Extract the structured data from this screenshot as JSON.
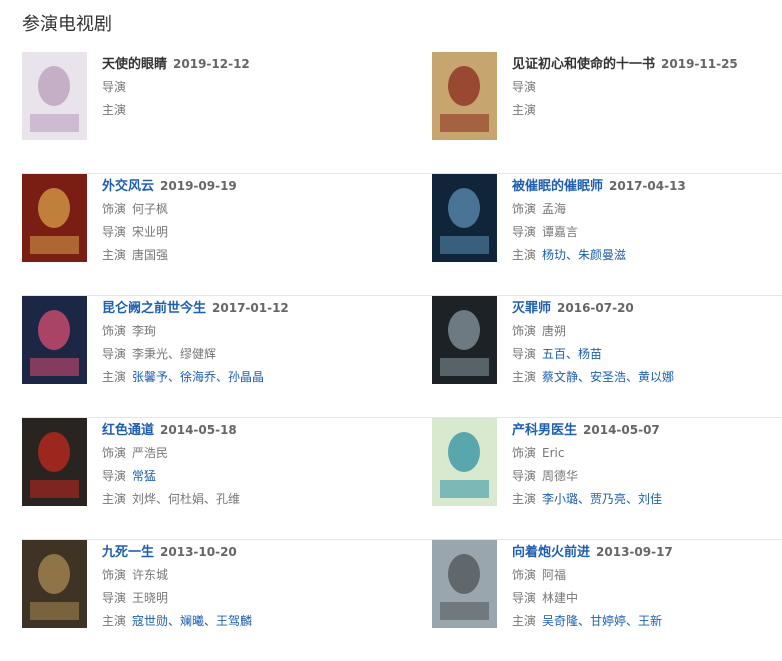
{
  "section": {
    "title": "参演电视剧"
  },
  "labels": {
    "role": "饰演",
    "director": "导演",
    "cast": "主演"
  },
  "rows": [
    [
      {
        "title": "天使的眼睛",
        "title_link": false,
        "date": "2019-12-12",
        "role": "",
        "director": "",
        "cast": "",
        "poster": {
          "bg": "#e9e3ec",
          "accent": "#b79dbb"
        }
      },
      {
        "title": "见证初心和使命的十一书",
        "title_link": false,
        "date": "2019-11-25",
        "role": "",
        "director": "",
        "cast": "",
        "poster": {
          "bg": "#c6a56e",
          "accent": "#8a2b1e"
        }
      }
    ],
    [
      {
        "title": "外交风云",
        "title_link": true,
        "date": "2019-09-19",
        "role": "何子枫",
        "director": "宋业明",
        "cast": "唐国强",
        "poster": {
          "bg": "#7a1e14",
          "accent": "#d8a24a"
        }
      },
      {
        "title": "被催眠的催眠师",
        "title_link": true,
        "date": "2017-04-13",
        "role": "孟海",
        "director": "谭嘉言",
        "cast": "杨玏、朱颜曼滋",
        "poster": {
          "bg": "#10243a",
          "accent": "#5d8fb4"
        }
      }
    ],
    [
      {
        "title": "昆仑阙之前世今生",
        "title_link": true,
        "date": "2017-01-12",
        "role": "李珣",
        "director": "李秉光、缪健辉",
        "cast": "张馨予、徐海乔、孙晶晶",
        "poster": {
          "bg": "#1b2744",
          "accent": "#d94f73"
        }
      },
      {
        "title": "灭罪师",
        "title_link": true,
        "date": "2016-07-20",
        "role": "唐朔",
        "director": "五百、杨苗",
        "cast": "蔡文静、安圣浩、黄以娜",
        "poster": {
          "bg": "#1c2226",
          "accent": "#8a98a0"
        }
      }
    ],
    [
      {
        "title": "红色通道",
        "title_link": true,
        "date": "2014-05-18",
        "role": "严浩民",
        "director": "常猛",
        "cast": "刘烨、何杜娟、孔维",
        "poster": {
          "bg": "#2a2421",
          "accent": "#c1281f"
        }
      },
      {
        "title": "产科男医生",
        "title_link": true,
        "date": "2014-05-07",
        "role": "Eric",
        "director": "周德华",
        "cast": "李小璐、贾乃亮、刘佳",
        "poster": {
          "bg": "#d9e9cf",
          "accent": "#2e8fa2"
        }
      }
    ],
    [
      {
        "title": "九死一生",
        "title_link": true,
        "date": "2013-10-20",
        "role": "许东城",
        "director": "王晓明",
        "cast": "寇世勋、斓曦、王驾麟",
        "poster": {
          "bg": "#3e3324",
          "accent": "#a98b53"
        }
      },
      {
        "title": "向着炮火前进",
        "title_link": true,
        "date": "2013-09-17",
        "role": "阿福",
        "director": "林建中",
        "cast": "吴奇隆、甘婷婷、王新",
        "poster": {
          "bg": "#9aa6ad",
          "accent": "#4c5357"
        }
      }
    ]
  ],
  "link_flags": {
    "director_links": [
      [
        false,
        false
      ],
      [
        false,
        false
      ],
      [
        false,
        true
      ],
      [
        true,
        false
      ],
      [
        false,
        false
      ]
    ],
    "cast_links": [
      [
        false,
        false
      ],
      [
        false,
        true
      ],
      [
        true,
        true
      ],
      [
        false,
        true
      ],
      [
        true,
        true
      ]
    ]
  }
}
